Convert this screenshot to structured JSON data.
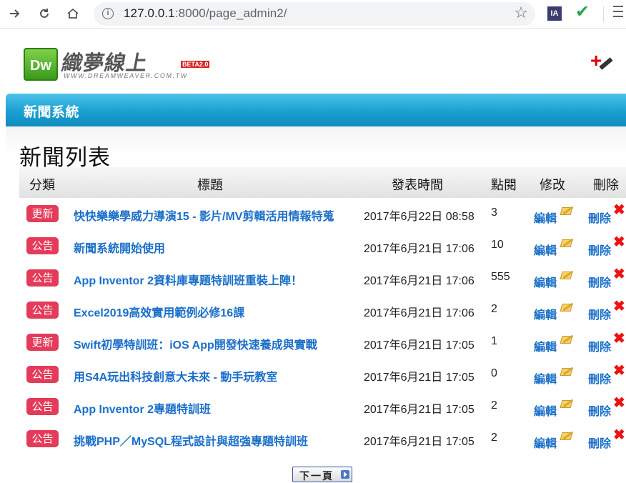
{
  "browser": {
    "url_host": "127.0.0.1",
    "url_rest": ":8000/page_admin2/",
    "ext_ia": "IA"
  },
  "site": {
    "logo_dw": "Dw",
    "logo_main": "織夢線上",
    "logo_beta": "BETA2.0",
    "logo_sub": "WWW.DREAMWEAVER.COM.TW"
  },
  "section": {
    "bar_title": "新聞系統",
    "page_title": "新聞列表"
  },
  "table": {
    "headers": {
      "category": "分類",
      "title": "標題",
      "date": "發表時間",
      "clicks": "點閱",
      "edit": "修改",
      "delete": "刪除"
    },
    "edit_label": "編輯",
    "delete_label": "刪除",
    "rows": [
      {
        "category": "更新",
        "title": "快快樂樂學威力導演15 - 影片/MV剪輯活用情報特蒐",
        "date": "2017年6月22日 08:58",
        "clicks": "3"
      },
      {
        "category": "公告",
        "title": "新聞系統開始使用",
        "date": "2017年6月21日 17:06",
        "clicks": "10"
      },
      {
        "category": "公告",
        "title": "App Inventor 2資料庫專題特訓班重裝上陣！",
        "date": "2017年6月21日 17:06",
        "clicks": "555"
      },
      {
        "category": "公告",
        "title": "Excel2019高效實用範例必修16課",
        "date": "2017年6月21日 17:06",
        "clicks": "2"
      },
      {
        "category": "更新",
        "title": "Swift初學特訓班：iOS App開發快速養成與實戰",
        "date": "2017年6月21日 17:05",
        "clicks": "1"
      },
      {
        "category": "公告",
        "title": "用S4A玩出科技創意大未來 - 動手玩教室",
        "date": "2017年6月21日 17:05",
        "clicks": "0"
      },
      {
        "category": "公告",
        "title": "App Inventor 2專題特訓班",
        "date": "2017年6月21日 17:05",
        "clicks": "2"
      },
      {
        "category": "公告",
        "title": "挑戰PHP／MySQL程式設計與超強專題特訓班",
        "date": "2017年6月21日 17:05",
        "clicks": "2"
      }
    ]
  },
  "pagination": {
    "next_label": "下一頁"
  },
  "colors": {
    "badge": "#e43b5a",
    "link": "#1a6fc9",
    "bar": "#1a9fd1"
  }
}
